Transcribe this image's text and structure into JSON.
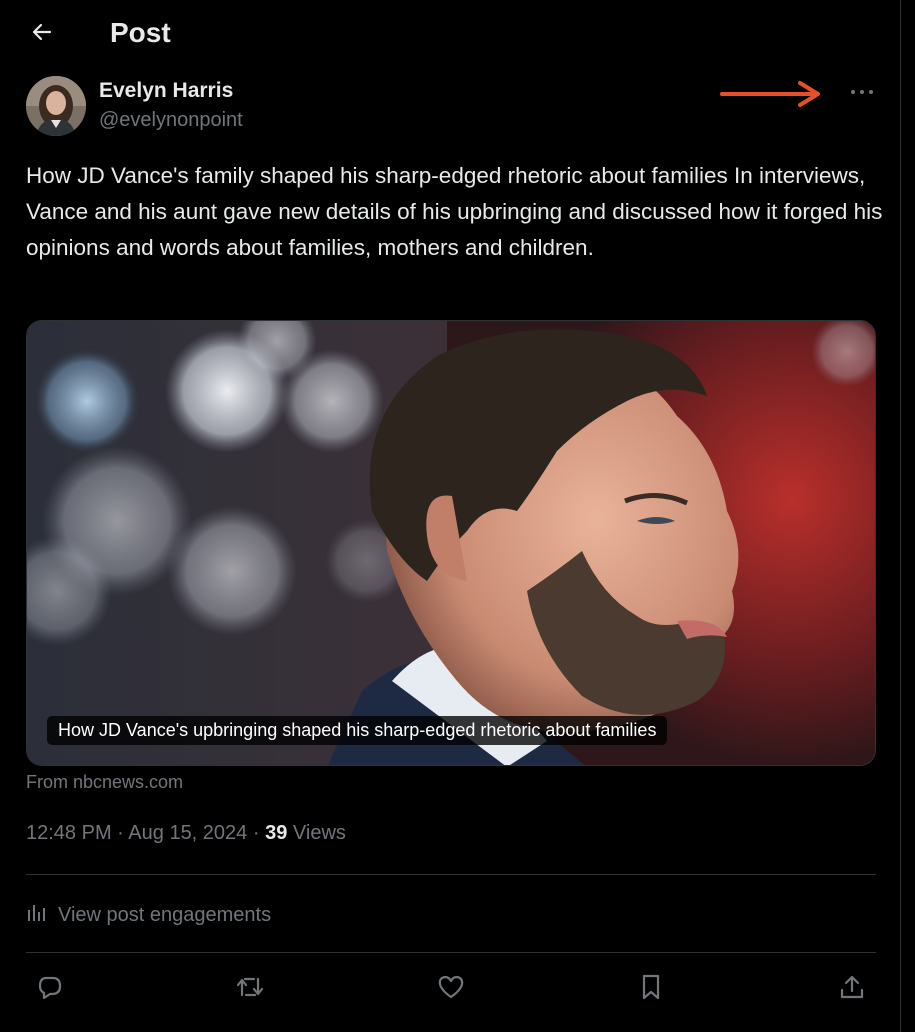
{
  "header": {
    "title": "Post"
  },
  "author": {
    "name": "Evelyn Harris",
    "handle": "@evelynonpoint"
  },
  "post": {
    "text": "How JD Vance's family shaped his sharp-edged rhetoric about families In interviews, Vance and his aunt gave new details of his upbringing and discussed how it forged his opinions and words about families, mothers and children."
  },
  "card": {
    "caption": "How JD Vance's upbringing shaped his sharp-edged rhetoric about families",
    "source": "From nbcnews.com"
  },
  "meta": {
    "time": "12:48 PM",
    "separator": "·",
    "date": "Aug 15, 2024",
    "views_count": "39",
    "views_label": "Views"
  },
  "engagements": {
    "label": "View post engagements"
  },
  "icons": {
    "back": "arrow-left-icon",
    "more": "more-dots-icon",
    "annotation": "red-arrow-icon",
    "reply": "reply-icon",
    "repost": "repost-icon",
    "like": "heart-icon",
    "bookmark": "bookmark-icon",
    "share": "share-icon",
    "analytics": "bar-chart-icon"
  },
  "colors": {
    "background": "#000000",
    "text": "#e7e9ea",
    "muted": "#71767b",
    "border": "#2f3336",
    "annotation": "#e8502a"
  }
}
